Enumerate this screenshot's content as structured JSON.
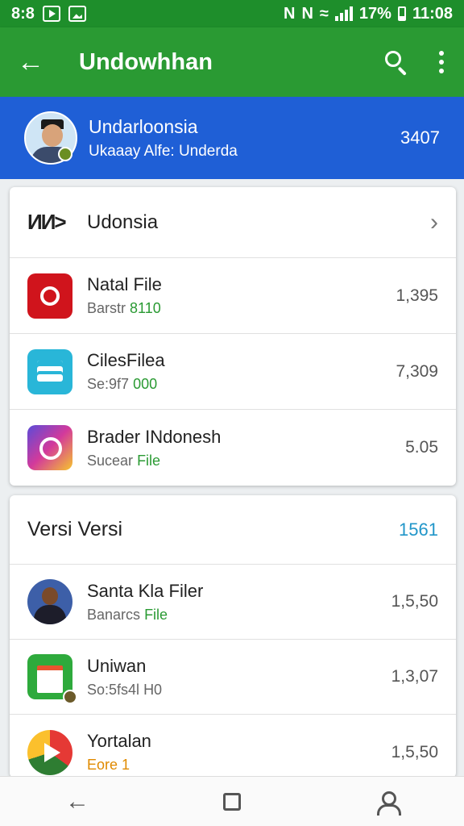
{
  "status_bar": {
    "time": "8:8",
    "icons": [
      "play-notification-icon",
      "image-notification-icon"
    ],
    "nfc_1": "N",
    "nfc_2": "N",
    "battery_percent": "17%",
    "clock": "11:08"
  },
  "app_bar": {
    "title": "Undowhhan",
    "back_icon": "arrow-left-icon",
    "search_icon": "search-icon",
    "more_icon": "more-vert-icon",
    "color": "#2a9a33"
  },
  "profile": {
    "name": "Undarloonsia",
    "subtitle": "Ukaaay Alfe: Underda",
    "count": "3407",
    "color": "#1f5fd6"
  },
  "card1": {
    "header": {
      "brand": "ИИ>",
      "label": "Udonsia",
      "chevron": "›"
    },
    "items": [
      {
        "title": "Natal File",
        "sub_prefix": "Barstr",
        "sub_accent": "8110",
        "value": "1,395",
        "icon": "red-circle-app-icon"
      },
      {
        "title": "CilesFilea",
        "sub_prefix": "Se:9f7",
        "sub_accent": "000",
        "value": "7,309",
        "icon": "document-app-icon"
      },
      {
        "title": "Brader INdonesh",
        "sub_prefix": "Sucear",
        "sub_accent": "File",
        "value": "5.05",
        "icon": "camera-app-icon"
      }
    ]
  },
  "card2": {
    "header": {
      "title": "Versi  Versi",
      "count": "1561"
    },
    "items": [
      {
        "title": "Santa Kla Filer",
        "sub_prefix": "Banarcs",
        "sub_accent": "File",
        "value": "1,5,50",
        "icon": "person-avatar-icon"
      },
      {
        "title": "Uniwan",
        "sub_prefix": "So:5fs4l",
        "sub_accent": "H0",
        "value": "1,3,07",
        "icon": "calendar-app-icon"
      },
      {
        "title": "Yortalan",
        "sub_prefix": "Eore",
        "sub_accent": "1",
        "value": "1,5,50",
        "icon": "play-app-icon"
      }
    ]
  },
  "nav_bar": {
    "back": "nav-back-icon",
    "home": "nav-home-icon",
    "account": "nav-account-icon"
  }
}
